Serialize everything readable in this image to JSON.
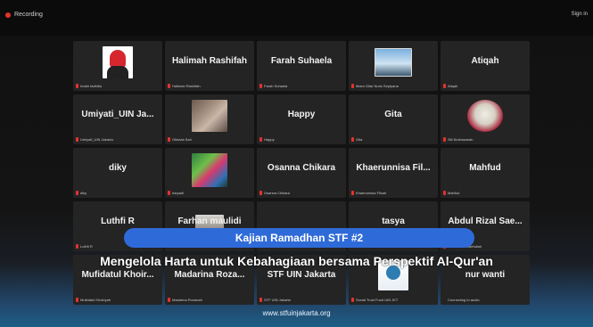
{
  "topbar": {
    "recording_label": "Recording",
    "signin_label": "Sign in"
  },
  "tiles": [
    {
      "display": "",
      "footer": "Indah fadhilla",
      "mic_muted": true,
      "photo": "pic-indah",
      "photo_name": "indah-photo"
    },
    {
      "display": "Halimah Rashifah",
      "footer": "Halimah Rashifah",
      "mic_muted": true
    },
    {
      "display": "Farah Suhaela",
      "footer": "Farah Suhaela",
      "mic_muted": true
    },
    {
      "display": "",
      "footer": "Ilham Gilar Nuris Septyana",
      "mic_muted": true,
      "photo": "pic-ilham",
      "photo_name": "ilham-photo"
    },
    {
      "display": "Atiqah",
      "footer": "Atiqah",
      "mic_muted": true
    },
    {
      "display": "Umiyati_UIN Ja...",
      "footer": "Umiyati_UIN Jakarta",
      "mic_muted": true
    },
    {
      "display": "",
      "footer": "Oktavia Sari",
      "mic_muted": true,
      "photo": "pic-oktavia",
      "photo_name": "oktavia-photo"
    },
    {
      "display": "Happy",
      "footer": "Happy",
      "mic_muted": true
    },
    {
      "display": "Gita",
      "footer": "Gita",
      "mic_muted": true
    },
    {
      "display": "",
      "footer": "Siti Nurhasanah",
      "mic_muted": true,
      "photo": "pic-siti",
      "photo_name": "siti-photo"
    },
    {
      "display": "diky",
      "footer": "diky",
      "mic_muted": true
    },
    {
      "display": "",
      "footer": "haryadi",
      "mic_muted": true,
      "photo": "pic-haryadi",
      "photo_name": "haryadi-photo"
    },
    {
      "display": "Osanna Chikara",
      "footer": "Osanna Chikara",
      "mic_muted": true
    },
    {
      "display": "Khaerunnisa Fil...",
      "footer": "Khaerunnisa Filzah",
      "mic_muted": true
    },
    {
      "display": "Mahfud",
      "footer": "Mahfud",
      "mic_muted": true
    },
    {
      "display": "Luthfi R",
      "footer": "Luthfi R",
      "mic_muted": true
    },
    {
      "display": "Farhan maulidi",
      "footer": "",
      "mic_muted": false,
      "photo": "pic-farhan",
      "photo_name": "farhan-photo"
    },
    {
      "display": "",
      "footer": "",
      "mic_muted": false
    },
    {
      "display": "tasya",
      "footer": "",
      "mic_muted": false
    },
    {
      "display": "Abdul Rizal Sae...",
      "footer": "Abdul Rizal Saefullah",
      "mic_muted": true
    },
    {
      "display": "Mufidatul Khoir...",
      "footer": "Mufidatul Khoiriyah",
      "mic_muted": true
    },
    {
      "display": "Madarina Roza...",
      "footer": "Madarina Rozanah",
      "mic_muted": true
    },
    {
      "display": "STF UIN Jakarta",
      "footer": "STF UIN Jakarta",
      "mic_muted": true
    },
    {
      "display": "",
      "footer": "Social Trust Fund UIN JKT",
      "mic_muted": true,
      "photo": "pic-social",
      "photo_name": "social-trust-fund-logo"
    },
    {
      "display": "nur wanti",
      "footer": "Connecting to audio",
      "mic_muted": false
    }
  ],
  "overlay": {
    "banner": "Kajian Ramadhan STF #2",
    "subtitle": "Mengelola Harta untuk Kebahagiaan bersama Perspektif Al-Qur'an",
    "website": "www.stfuinjakarta.org"
  },
  "colors": {
    "banner": "#2f6bd8",
    "muted_mic": "#e5322d",
    "tile": "#242424",
    "background": "#111111"
  }
}
